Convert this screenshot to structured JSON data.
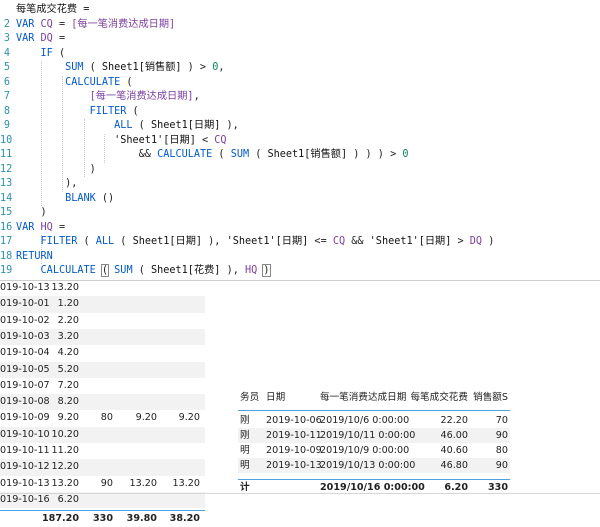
{
  "editor": {
    "lines": [
      {
        "n": "",
        "parts": [
          [
            "tx",
            "每笔成交花费 ="
          ]
        ]
      },
      {
        "n": "2",
        "parts": [
          [
            "kw",
            "VAR "
          ],
          [
            "va",
            "CQ"
          ],
          [
            "pu",
            " = "
          ],
          [
            "va",
            "[每一笔消费达成日期]"
          ]
        ]
      },
      {
        "n": "3",
        "parts": [
          [
            "kw",
            "VAR "
          ],
          [
            "va",
            "DQ"
          ],
          [
            "pu",
            " ="
          ]
        ]
      },
      {
        "n": "4",
        "parts": [
          [
            "pu",
            "    "
          ],
          [
            "fn",
            "IF"
          ],
          [
            "pu",
            " ("
          ]
        ]
      },
      {
        "n": "5",
        "parts": [
          [
            "pu",
            "        "
          ],
          [
            "fn",
            "SUM"
          ],
          [
            "pu",
            " ( "
          ],
          [
            "tx",
            "Sheet1[销售额]"
          ],
          [
            "pu",
            " ) > "
          ],
          [
            "nu",
            "0"
          ],
          [
            "pu",
            ","
          ]
        ]
      },
      {
        "n": "6",
        "parts": [
          [
            "pu",
            "        "
          ],
          [
            "fn",
            "CALCULATE"
          ],
          [
            "pu",
            " ("
          ]
        ]
      },
      {
        "n": "7",
        "parts": [
          [
            "pu",
            "            "
          ],
          [
            "va",
            "[每一笔消费达成日期]"
          ],
          [
            "pu",
            ","
          ]
        ]
      },
      {
        "n": "8",
        "parts": [
          [
            "pu",
            "            "
          ],
          [
            "fn",
            "FILTER"
          ],
          [
            "pu",
            " ("
          ]
        ]
      },
      {
        "n": "9",
        "parts": [
          [
            "pu",
            "                "
          ],
          [
            "fn",
            "ALL"
          ],
          [
            "pu",
            " ( "
          ],
          [
            "tx",
            "Sheet1[日期]"
          ],
          [
            "pu",
            " ),"
          ]
        ]
      },
      {
        "n": "10",
        "parts": [
          [
            "pu",
            "                "
          ],
          [
            "tx",
            "'Sheet1'[日期]"
          ],
          [
            "pu",
            " < "
          ],
          [
            "va",
            "CQ"
          ]
        ]
      },
      {
        "n": "11",
        "parts": [
          [
            "pu",
            "                    && "
          ],
          [
            "fn",
            "CALCULATE"
          ],
          [
            "pu",
            " ( "
          ],
          [
            "fn",
            "SUM"
          ],
          [
            "pu",
            " ( "
          ],
          [
            "tx",
            "Sheet1[销售额]"
          ],
          [
            "pu",
            " ) ) ) > "
          ],
          [
            "nu",
            "0"
          ]
        ]
      },
      {
        "n": "12",
        "parts": [
          [
            "pu",
            "            )"
          ]
        ]
      },
      {
        "n": "13",
        "parts": [
          [
            "pu",
            "        ),"
          ]
        ]
      },
      {
        "n": "14",
        "parts": [
          [
            "pu",
            "        "
          ],
          [
            "fn",
            "BLANK"
          ],
          [
            "pu",
            " ()"
          ]
        ]
      },
      {
        "n": "15",
        "parts": [
          [
            "pu",
            "    )"
          ]
        ]
      },
      {
        "n": "16",
        "parts": [
          [
            "kw",
            "VAR "
          ],
          [
            "va",
            "HQ"
          ],
          [
            "pu",
            " ="
          ]
        ]
      },
      {
        "n": "17",
        "parts": [
          [
            "pu",
            "    "
          ],
          [
            "fn",
            "FILTER"
          ],
          [
            "pu",
            " ( "
          ],
          [
            "fn",
            "ALL"
          ],
          [
            "pu",
            " ( "
          ],
          [
            "tx",
            "Sheet1[日期]"
          ],
          [
            "pu",
            " ), "
          ],
          [
            "tx",
            "'Sheet1'[日期]"
          ],
          [
            "pu",
            " <= "
          ],
          [
            "va",
            "CQ"
          ],
          [
            "pu",
            " && "
          ],
          [
            "tx",
            "'Sheet1'[日期]"
          ],
          [
            "pu",
            " > "
          ],
          [
            "va",
            "DQ"
          ],
          [
            "pu",
            " )"
          ]
        ]
      },
      {
        "n": "18",
        "parts": [
          [
            "kw",
            "RETURN"
          ]
        ]
      },
      {
        "n": "19",
        "parts": [
          [
            "pu",
            "    "
          ],
          [
            "fn",
            "CALCULATE"
          ],
          [
            "pu",
            " "
          ],
          [
            "cur",
            "("
          ],
          [
            "pu",
            " "
          ],
          [
            "fn",
            "SUM"
          ],
          [
            "pu",
            " ( "
          ],
          [
            "tx",
            "Sheet1[花费]"
          ],
          [
            "pu",
            " ), "
          ],
          [
            "va",
            "HQ"
          ],
          [
            "pu",
            " "
          ],
          [
            "cur",
            ")"
          ]
        ]
      }
    ]
  },
  "left_table": {
    "rows": [
      [
        "019-10-13",
        "13.20",
        "",
        "",
        ""
      ],
      [
        "019-10-01",
        "1.20",
        "",
        "",
        ""
      ],
      [
        "019-10-02",
        "2.20",
        "",
        "",
        ""
      ],
      [
        "019-10-03",
        "3.20",
        "",
        "",
        ""
      ],
      [
        "019-10-04",
        "4.20",
        "",
        "",
        ""
      ],
      [
        "019-10-05",
        "5.20",
        "",
        "",
        ""
      ],
      [
        "019-10-07",
        "7.20",
        "",
        "",
        ""
      ],
      [
        "019-10-08",
        "8.20",
        "",
        "",
        ""
      ],
      [
        "019-10-09",
        "9.20",
        "80",
        "9.20",
        "9.20"
      ],
      [
        "019-10-10",
        "10.20",
        "",
        "",
        ""
      ],
      [
        "019-10-11",
        "11.20",
        "",
        "",
        ""
      ],
      [
        "019-10-12",
        "12.20",
        "",
        "",
        ""
      ],
      [
        "019-10-13",
        "13.20",
        "90",
        "13.20",
        "13.20"
      ],
      [
        "019-10-16",
        "6.20",
        "",
        "",
        ""
      ]
    ],
    "total": [
      "",
      "187.20",
      "330",
      "39.80",
      "38.20"
    ]
  },
  "right_table": {
    "headers": [
      "务员",
      "日期",
      "每一笔消费达成日期",
      "每笔成交花费",
      "销售额S"
    ],
    "rows": [
      [
        "刚",
        "2019-10-06",
        "2019/10/6 0:00:00",
        "22.20",
        "70"
      ],
      [
        "刚",
        "2019-10-11",
        "2019/10/11 0:00:00",
        "46.00",
        "90"
      ],
      [
        "明",
        "2019-10-09",
        "2019/10/9 0:00:00",
        "40.60",
        "80"
      ],
      [
        "明",
        "2019-10-13",
        "2019/10/13 0:00:00",
        "46.80",
        "90"
      ]
    ],
    "total": [
      "计",
      "",
      "2019/10/16 0:00:00",
      "6.20",
      "330"
    ]
  }
}
